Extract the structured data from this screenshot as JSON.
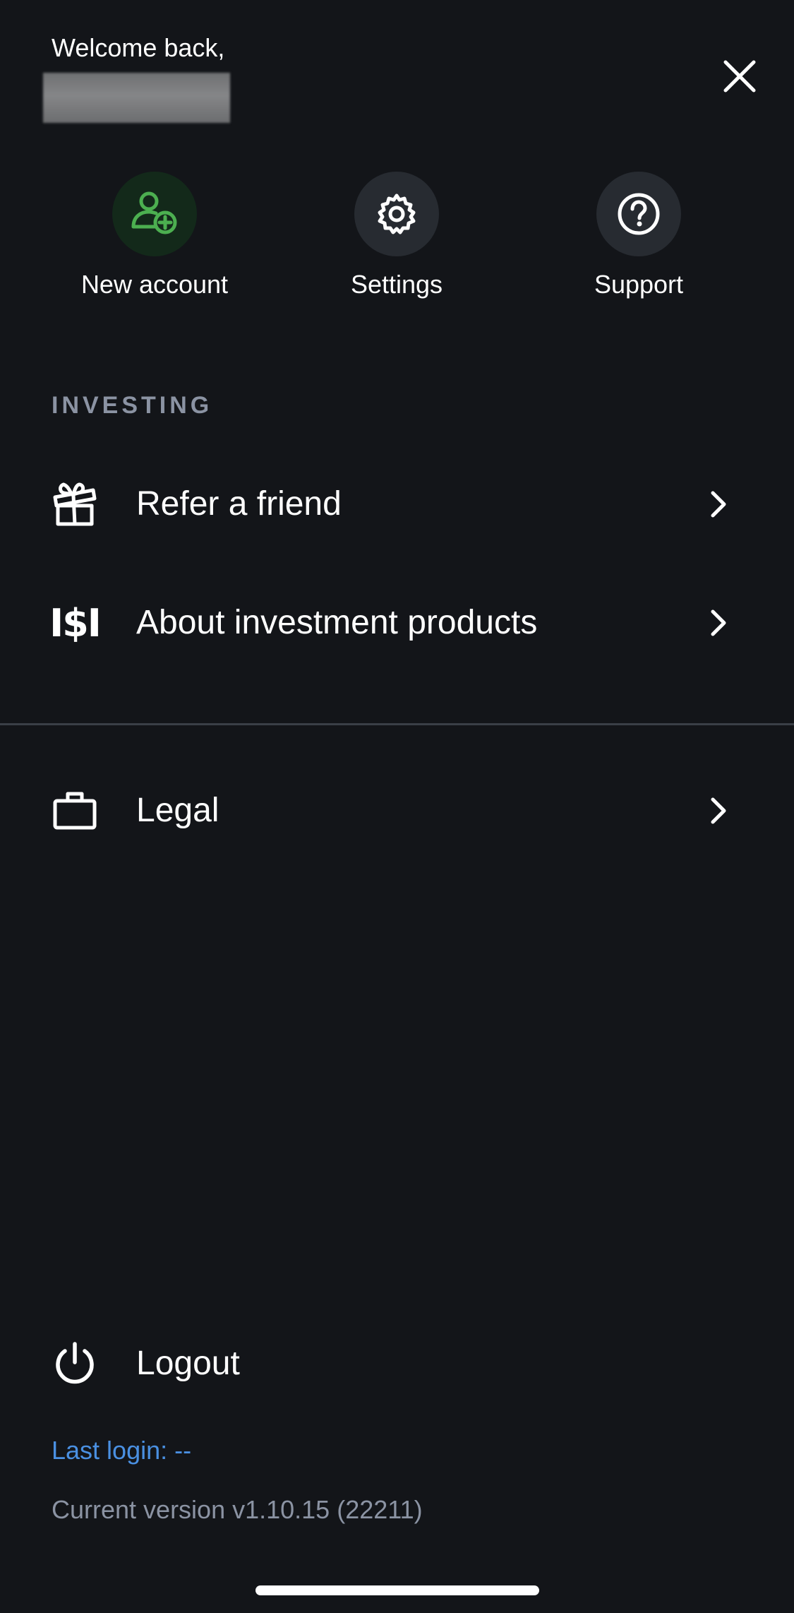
{
  "header": {
    "welcome_text": "Welcome back,"
  },
  "quick_actions": [
    {
      "label": "New account",
      "icon": "add-user-icon",
      "color": "#4caf50"
    },
    {
      "label": "Settings",
      "icon": "gear-icon"
    },
    {
      "label": "Support",
      "icon": "question-circle-icon"
    }
  ],
  "investing": {
    "section_title": "INVESTING",
    "items": [
      {
        "label": "Refer a friend",
        "icon": "gift-icon"
      },
      {
        "label": "About investment products",
        "icon": "dollar-icon",
        "icon_text": "I$I"
      }
    ]
  },
  "other": {
    "items": [
      {
        "label": "Legal",
        "icon": "briefcase-icon"
      }
    ]
  },
  "logout": {
    "label": "Logout",
    "icon": "power-icon"
  },
  "footer": {
    "last_login": "Last login: --",
    "version": "Current version v1.10.15 (22211)"
  },
  "colors": {
    "background": "#131519",
    "accent_green": "#4caf50",
    "link_blue": "#4a90e2",
    "muted_text": "#8b93a3"
  }
}
